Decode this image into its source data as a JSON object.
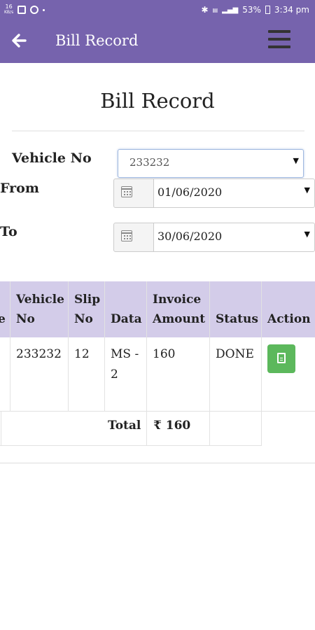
{
  "status_bar": {
    "left_top": "16",
    "left_bottom": "KB/s",
    "battery": "53%",
    "time": "3:34 pm"
  },
  "app_bar": {
    "title": "Bill Record",
    "back_icon": "arrow-left-icon",
    "menu_icon": "hamburger-menu-icon"
  },
  "page": {
    "title": "Bill Record"
  },
  "filters": {
    "vehicle_label": "Vehicle No",
    "vehicle_value": "233232",
    "from_label": "From",
    "from_value": "01/06/2020",
    "to_label": "To",
    "to_value": "30/06/2020"
  },
  "table": {
    "partial_left_header": "e",
    "headers": {
      "vehicle_no": [
        "Vehicle",
        "No"
      ],
      "slip_no": [
        "Slip",
        "No"
      ],
      "data": "Data",
      "invoice_amount": [
        "Invoice",
        "Amount"
      ],
      "status": "Status",
      "action": "Action"
    },
    "rows": [
      {
        "vehicle_no": "233232",
        "slip_no": "12",
        "data": [
          "MS -",
          "2"
        ],
        "invoice_amount": "160",
        "status": "DONE",
        "action_icon": "document-icon"
      }
    ],
    "total_label": "Total",
    "total_value": "₹ 160"
  },
  "colors": {
    "primary": "#7663ad",
    "header_bg": "#d3cce9",
    "action_button": "#5cb85c"
  }
}
